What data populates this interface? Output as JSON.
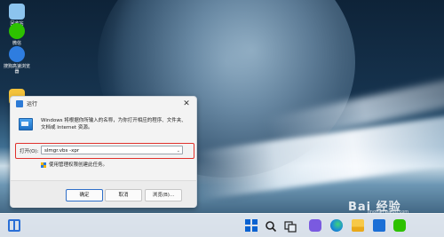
{
  "desktop": {
    "icons": [
      {
        "label": "回收站",
        "color": "#8cc4ee"
      },
      {
        "label": "微信",
        "color": "#2dc100"
      },
      {
        "label": "搜狗高速浏览器",
        "color": "#2e7de0"
      },
      {
        "label": "",
        "color": "#f3c23b"
      }
    ]
  },
  "dialog": {
    "title": "运行",
    "close_label": "✕",
    "description": "Windows 将根据你所输入的名称，为你打开相应的程序、文件夹、文档或 Internet 资源。",
    "open_label": "打开(O):",
    "command_value": "slmgr.vbs -xpr",
    "dropdown_glyph": "⌄",
    "admin_text": "使用管理权限创建此任务。",
    "buttons": {
      "ok": "确定",
      "cancel": "取消",
      "browse": "浏览(B)..."
    },
    "highlight_color": "#e0322d"
  },
  "taskbar": {
    "icons": [
      "widgets-icon",
      "start-icon",
      "search-icon",
      "task-view-icon",
      "chat-icon",
      "edge-icon",
      "file-explorer-icon",
      "store-icon",
      "wechat-icon"
    ]
  },
  "watermark": {
    "brand": "Bai 经验",
    "sub": "jingyan.baidu.com"
  }
}
